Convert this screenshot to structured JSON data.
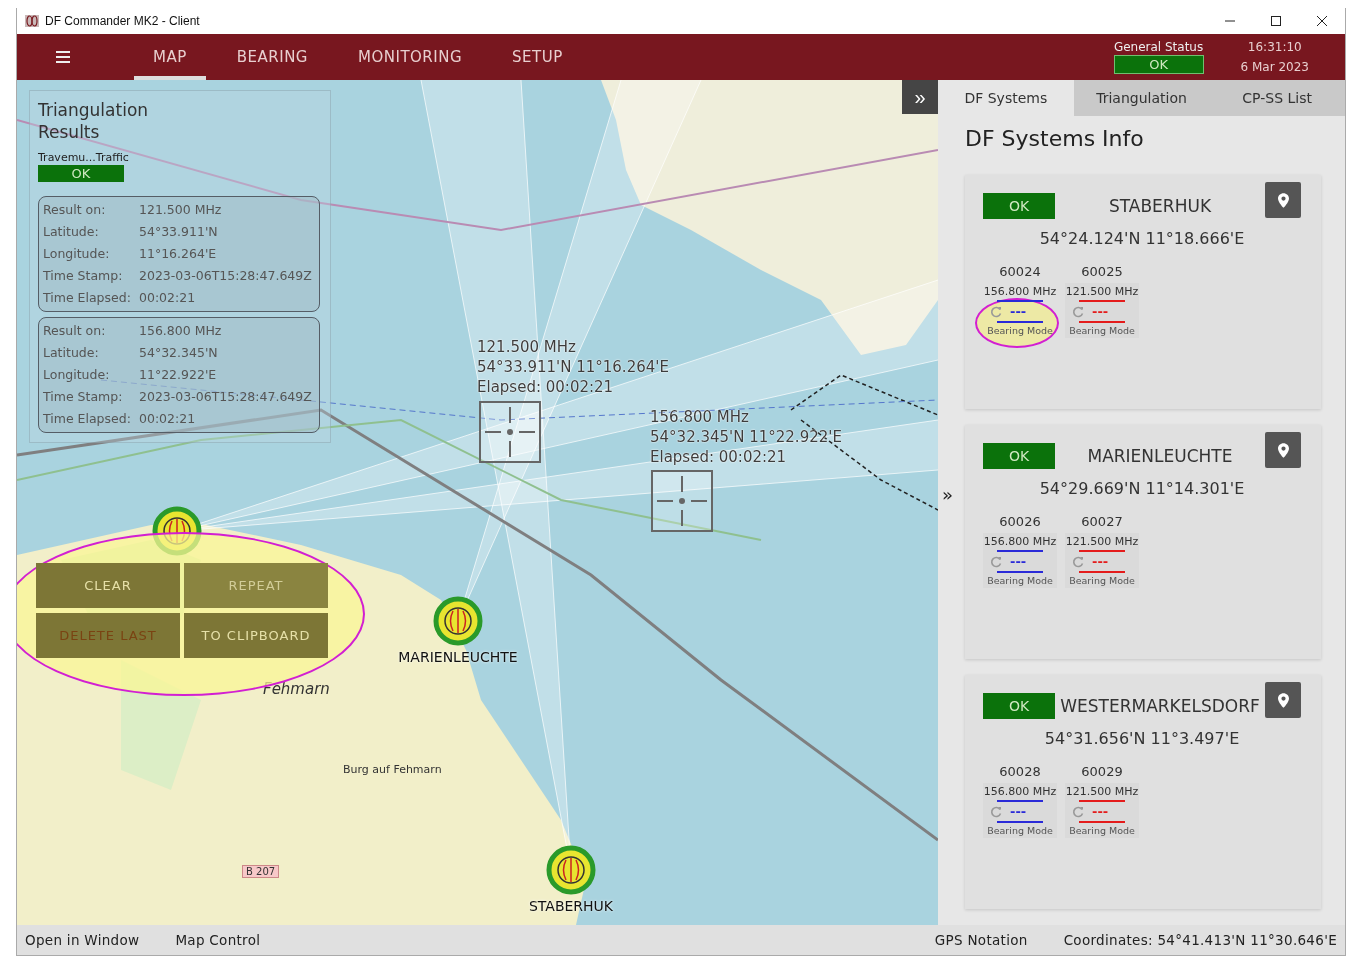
{
  "window": {
    "title": "DF Commander MK2 - Client"
  },
  "nav": {
    "tabs": [
      {
        "label": "MAP",
        "selected": true
      },
      {
        "label": "BEARING",
        "selected": false
      },
      {
        "label": "MONITORING",
        "selected": false
      },
      {
        "label": "SETUP",
        "selected": false
      }
    ]
  },
  "general_status": {
    "label": "General Status",
    "value": "OK",
    "ok": true
  },
  "clock": {
    "time": "16:31:10",
    "date": "6 Mar 2023"
  },
  "map": {
    "collapse_button": "»",
    "place_labels": [
      {
        "text": "Fehmarn",
        "kind": "island"
      },
      {
        "text": "Burg auf Fehmarn",
        "kind": "town"
      },
      {
        "text": "B 207",
        "kind": "road"
      }
    ],
    "stations": [
      {
        "name": "MARIENLEUCHTE"
      },
      {
        "name": "STABERHUK"
      }
    ],
    "fixes": [
      {
        "frequency": "121.500 MHz",
        "coordinates": "54°33.911'N 11°16.264'E",
        "elapsed": "Elapsed: 00:02:21"
      },
      {
        "frequency": "156.800 MHz",
        "coordinates": "54°32.345'N 11°22.922'E",
        "elapsed": "Elapsed: 00:02:21"
      }
    ],
    "triangulation": {
      "title": "Triangulation Results",
      "station": "Travemu...Traffic",
      "status": "OK",
      "ok": true,
      "results": [
        {
          "rows": [
            {
              "label": "Result on:",
              "value": "121.500 MHz"
            },
            {
              "label": "Latitude:",
              "value": "54°33.911'N"
            },
            {
              "label": "Longitude:",
              "value": "11°16.264'E"
            },
            {
              "label": "Time Stamp:",
              "value": "2023-03-06T15:28:47.649Z"
            },
            {
              "label": "Time Elapsed:",
              "value": "00:02:21"
            }
          ]
        },
        {
          "rows": [
            {
              "label": "Result on:",
              "value": "156.800 MHz"
            },
            {
              "label": "Latitude:",
              "value": "54°32.345'N"
            },
            {
              "label": "Longitude:",
              "value": "11°22.922'E"
            },
            {
              "label": "Time Stamp:",
              "value": "2023-03-06T15:28:47.649Z"
            },
            {
              "label": "Time Elapsed:",
              "value": "00:02:21"
            }
          ]
        }
      ]
    },
    "actions": [
      {
        "label": "CLEAR",
        "kind": "normal",
        "disabled": false
      },
      {
        "label": "REPEAT",
        "kind": "normal",
        "disabled": true
      },
      {
        "label": "DELETE LAST",
        "kind": "danger",
        "disabled": false
      },
      {
        "label": "TO CLIPBOARD",
        "kind": "normal",
        "disabled": false
      }
    ]
  },
  "expand_arrow": "»",
  "sidebar": {
    "tabs": [
      {
        "label": "DF Systems",
        "selected": true
      },
      {
        "label": "Triangulation",
        "selected": false
      },
      {
        "label": "CP-SS List",
        "selected": false
      }
    ],
    "title": "DF Systems Info",
    "systems": [
      {
        "status": "OK",
        "ok": true,
        "name": "STABERHUK",
        "coordinates": "54°24.124'N 11°18.666'E",
        "channels": [
          {
            "id": "60024",
            "frequency": "156.800 MHz",
            "color": "#2a2ad8",
            "reading": "---",
            "mode": "Bearing Mode",
            "highlighted": true
          },
          {
            "id": "60025",
            "frequency": "121.500 MHz",
            "color": "#e41c1c",
            "reading": "---",
            "mode": "Bearing Mode",
            "highlighted": false
          }
        ]
      },
      {
        "status": "OK",
        "ok": true,
        "name": "MARIENLEUCHTE",
        "coordinates": "54°29.669'N 11°14.301'E",
        "channels": [
          {
            "id": "60026",
            "frequency": "156.800 MHz",
            "color": "#2a2ad8",
            "reading": "---",
            "mode": "Bearing Mode",
            "highlighted": false
          },
          {
            "id": "60027",
            "frequency": "121.500 MHz",
            "color": "#e41c1c",
            "reading": "---",
            "mode": "Bearing Mode",
            "highlighted": false
          }
        ]
      },
      {
        "status": "OK",
        "ok": true,
        "name": "WESTERMARKELSDORF",
        "coordinates": "54°31.656'N 11°3.497'E",
        "channels": [
          {
            "id": "60028",
            "frequency": "156.800 MHz",
            "color": "#2a2ad8",
            "reading": "---",
            "mode": "Bearing Mode",
            "highlighted": false
          },
          {
            "id": "60029",
            "frequency": "121.500 MHz",
            "color": "#e41c1c",
            "reading": "---",
            "mode": "Bearing Mode",
            "highlighted": false
          }
        ]
      }
    ]
  },
  "status_bar": {
    "left": [
      "Open in Window",
      "Map Control"
    ],
    "right": [
      "GPS Notation",
      "Coordinates: 54°41.413'N 11°30.646'E"
    ]
  }
}
